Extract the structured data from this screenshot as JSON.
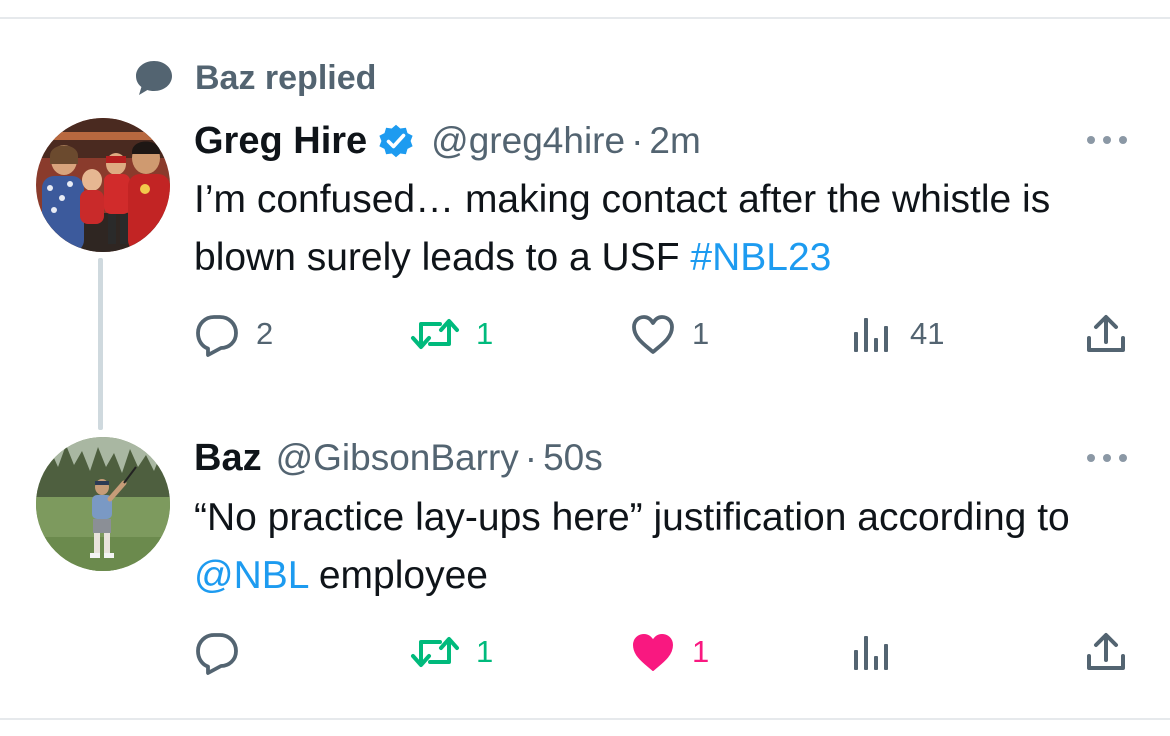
{
  "context": {
    "icon": "speech-bubble-icon",
    "text": "Baz replied"
  },
  "tweets": [
    {
      "display_name": "Greg Hire",
      "verified": true,
      "handle": "@greg4hire",
      "separator": "·",
      "time": "2m",
      "text_before": "I’m confused… making contact after the whistle is blown surely leads to a USF ",
      "link": "#NBL23",
      "text_after": "",
      "actions": {
        "replies": "2",
        "retweets": "1",
        "likes": "1",
        "views": "41"
      },
      "liked": false
    },
    {
      "display_name": "Baz",
      "verified": false,
      "handle": "@GibsonBarry",
      "separator": "·",
      "time": "50s",
      "text_before": "“No practice lay-ups here” justification according to ",
      "link": "@NBL",
      "text_after": " employee",
      "actions": {
        "replies": "",
        "retweets": "1",
        "likes": "1",
        "views": ""
      },
      "liked": true
    }
  ],
  "colors": {
    "link": "#1d9bf0",
    "secondary_text": "#536471",
    "retweet_green": "#00ba7c",
    "like_pink": "#f91880",
    "thread_line": "#cfd9de"
  }
}
